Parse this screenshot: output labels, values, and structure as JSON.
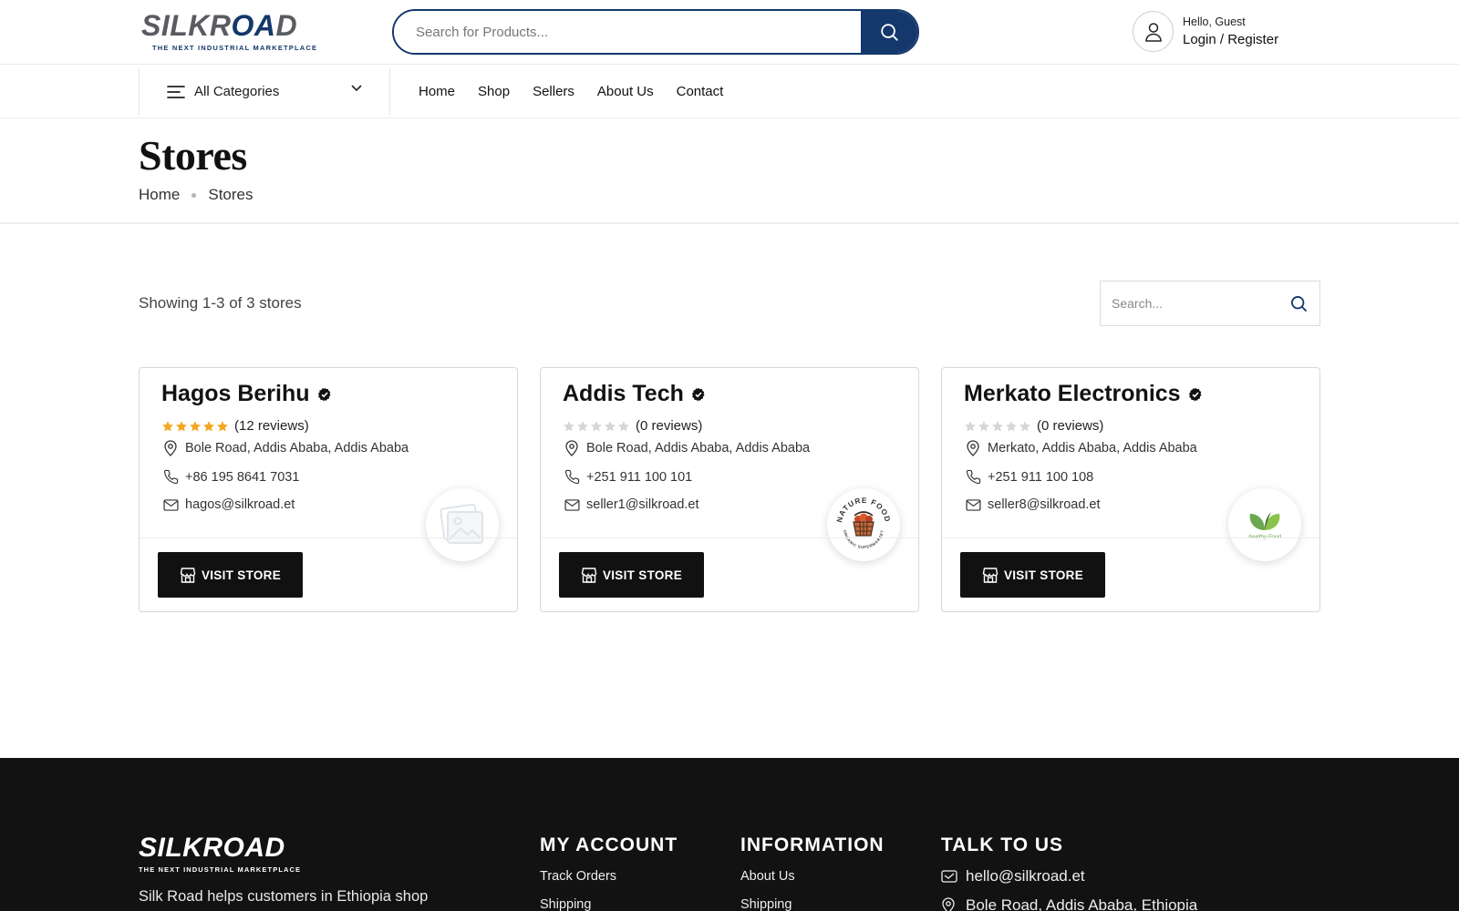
{
  "header": {
    "logo_word": "SILKROAD",
    "logo_tagline": "THE NEXT INDUSTRIAL MARKETPLACE",
    "search_placeholder": "Search for Products...",
    "greeting": "Hello, Guest",
    "login_label": "Login / Register"
  },
  "nav": {
    "categories_label": "All Categories",
    "links": [
      "Home",
      "Shop",
      "Sellers",
      "About Us",
      "Contact"
    ]
  },
  "page": {
    "title": "Stores",
    "breadcrumb": [
      "Home",
      "Stores"
    ]
  },
  "toolbar": {
    "showing_text": "Showing 1-3 of 3 stores",
    "search_placeholder": "Search..."
  },
  "stores": [
    {
      "name": "Hagos Berihu",
      "stars": 5,
      "reviews": "(12 reviews)",
      "address": "Bole Road, Addis Ababa, Addis Ababa",
      "phone": "+86 195 8641 7031",
      "email": "hagos@silkroad.et",
      "logo": "placeholder-image-icon",
      "visit_label": "VISIT STORE"
    },
    {
      "name": "Addis Tech",
      "stars": 0,
      "reviews": "(0 reviews)",
      "address": "Bole Road, Addis Ababa, Addis Ababa",
      "phone": "+251 911 100 101",
      "email": "seller1@silkroad.et",
      "logo": "nature-food-logo",
      "logo_text_top": "NATURE FOOD",
      "logo_text_bottom": "ORGANIC SUPERMARKET",
      "visit_label": "VISIT STORE"
    },
    {
      "name": "Merkato Electronics",
      "stars": 0,
      "reviews": "(0 reviews)",
      "address": "Merkato, Addis Ababa, Addis Ababa",
      "phone": "+251 911 100 108",
      "email": "seller8@silkroad.et",
      "logo": "healthy-food-logo",
      "logo_text": "healthy Food",
      "visit_label": "VISIT STORE"
    }
  ],
  "colors": {
    "brand_navy": "#14386b",
    "star_filled": "#f5a623",
    "star_empty": "#d6d6d6",
    "button_dark": "#111111",
    "footer_bg": "#121212"
  },
  "footer": {
    "logo_word": "SILKROAD",
    "logo_tagline": "THE NEXT INDUSTRIAL MARKETPLACE",
    "about": "Silk Road helps customers in Ethiopia shop products closely available in a live",
    "my_account_title": "MY ACCOUNT",
    "my_account_links": [
      "Track Orders",
      "Shipping"
    ],
    "information_title": "INFORMATION",
    "information_links": [
      "About Us",
      "Shipping"
    ],
    "talk_title": "TALK TO US",
    "email": "hello@silkroad.et",
    "address": "Bole Road, Addis Ababa, Ethiopia"
  }
}
